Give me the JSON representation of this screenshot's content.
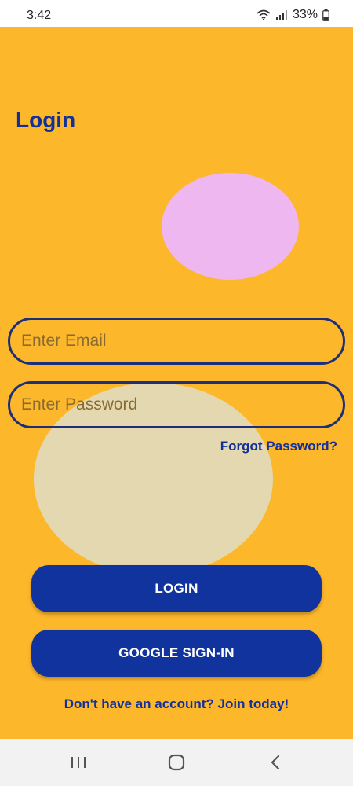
{
  "status_bar": {
    "time": "3:42",
    "battery_percent": "33%",
    "icons": [
      "wifi-icon",
      "signal-icon",
      "battery-icon"
    ]
  },
  "login": {
    "title": "Login",
    "email_placeholder": "Enter Email",
    "password_placeholder": "Enter Password",
    "forgot_password": "Forgot Password?",
    "login_button": "LOGIN",
    "google_button": "GOOGLE SIGN-IN",
    "signup_link": "Don't have an account? Join today!"
  },
  "nav_bar": {
    "icons": [
      "recents-icon",
      "home-icon",
      "back-icon"
    ]
  },
  "colors": {
    "background": "#FDB72B",
    "primary": "#11339E",
    "pink_shape": "#EEB7F0",
    "cream_shape": "#E3D8B0"
  }
}
